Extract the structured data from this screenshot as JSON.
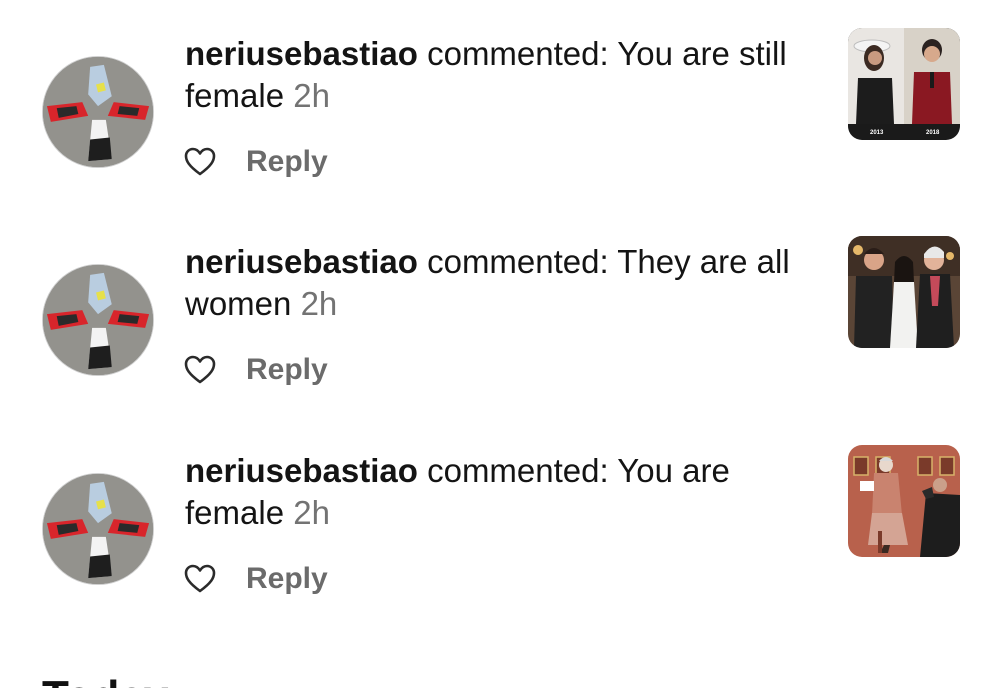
{
  "notifications": [
    {
      "username": "neriusebastiao",
      "action": "commented:",
      "comment": "You are still female",
      "time": "2h",
      "reply_label": "Reply",
      "thumbnail_labels": [
        "2013",
        "2018"
      ]
    },
    {
      "username": "neriusebastiao",
      "action": "commented:",
      "comment": "They are all women",
      "time": "2h",
      "reply_label": "Reply"
    },
    {
      "username": "neriusebastiao",
      "action": "commented:",
      "comment": "You are female",
      "time": "2h",
      "reply_label": "Reply"
    }
  ],
  "section": {
    "title": "Today"
  },
  "icons": {
    "like": "heart-outline-icon"
  },
  "colors": {
    "text": "#141414",
    "secondary": "#737373",
    "reply": "#6b6b6b"
  }
}
